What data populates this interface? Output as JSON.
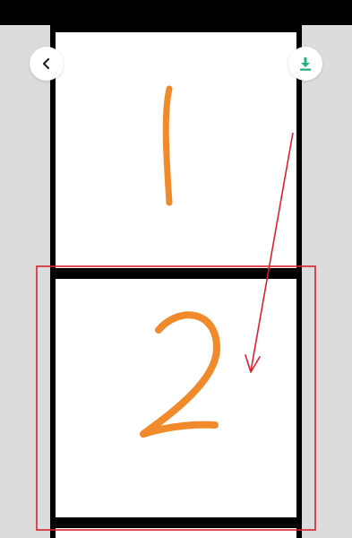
{
  "toolbar": {
    "back_icon": "chevron-left-icon",
    "download_icon": "download-icon",
    "download_color": "#27b07a"
  },
  "panels": [
    {
      "label": "1"
    },
    {
      "label": "2"
    },
    {
      "label": ""
    }
  ],
  "colors": {
    "stroke": "#f08a2a",
    "annotation": "#d8222e",
    "frame": "#000000",
    "background": "#dcdcdc"
  }
}
